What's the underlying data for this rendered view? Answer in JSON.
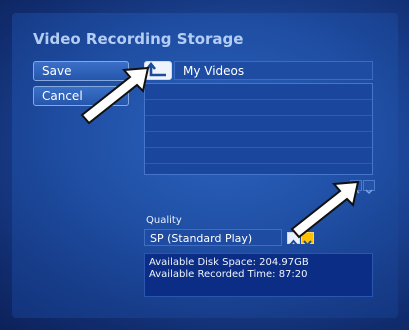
{
  "window": {
    "title": "Video Recording Storage"
  },
  "buttons": {
    "save": "Save",
    "cancel": "Cancel"
  },
  "folder": {
    "current": "My Videos",
    "rows": 6
  },
  "quality": {
    "label": "Quality",
    "selected": "SP (Standard Play)"
  },
  "info": {
    "disk_space": "Available Disk Space: 204.97GB",
    "recorded_time": "Available Recorded Time: 87:20"
  },
  "icons": {
    "up": "up-folder-arrow-icon",
    "scroll_up": "chevron-up-icon",
    "scroll_down": "chevron-down-icon",
    "pointer": "white-arrow-pointer-icon"
  },
  "colors": {
    "accent": "#ffc000",
    "title_text": "#b4cdf2",
    "background": "#1c4596"
  }
}
